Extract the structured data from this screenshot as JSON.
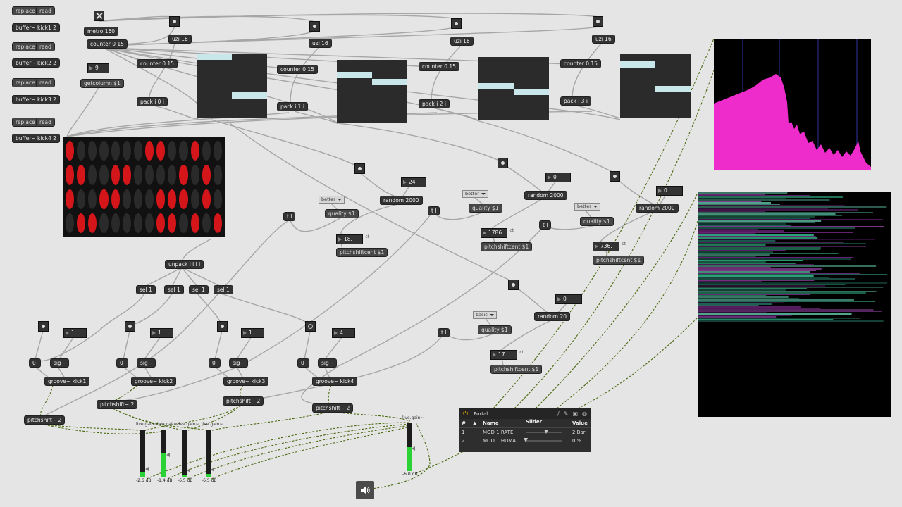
{
  "messages": {
    "replace": "replace",
    "read": "read",
    "getcolumn": "getcolumn $1",
    "quality": "quality $1",
    "pitchshiftcent": "pitchshiftcent $1"
  },
  "buffers": [
    "buffer~ kick1 2",
    "buffer~ kick2 2",
    "buffer~ kick3 2",
    "buffer~ kick4 2"
  ],
  "objects": {
    "metro": "metro 160",
    "counter_main": "counter 0 15",
    "uzi": "uzi 16",
    "counter": "counter 0 15",
    "pack": [
      "pack i 0 i",
      "pack i 1 i",
      "pack i 2 i",
      "pack i 3 i"
    ],
    "unpack": "unpack i i i i",
    "sel": [
      "sel 1",
      "sel 1",
      "sel 1",
      "sel 1"
    ],
    "random2000": "random 2000",
    "random20": "random 20",
    "trigger": "t l",
    "sig": "sig~",
    "groove": [
      "groove~ kick1",
      "groove~ kick2",
      "groove~ kick3",
      "groove~ kick4"
    ],
    "pitchshift": "pitchshift~ 2"
  },
  "numbers": {
    "column_index": "9",
    "random_max": "24",
    "zero": "0",
    "cent_values": [
      "18.",
      "1786.",
      "736.",
      "17."
    ],
    "cent_unit": "ct",
    "speeds": [
      "1.",
      "1.",
      "1.",
      "4."
    ]
  },
  "menus": {
    "quality_options": [
      "better",
      "better",
      "better",
      "basic"
    ]
  },
  "step_grid": {
    "rows": 4,
    "cols": 14,
    "active": [
      [
        1,
        0,
        0,
        0,
        0,
        0,
        0,
        1,
        1,
        0,
        0,
        1,
        0,
        0
      ],
      [
        1,
        1,
        0,
        0,
        1,
        1,
        0,
        0,
        0,
        0,
        1,
        0,
        1,
        0
      ],
      [
        1,
        0,
        0,
        1,
        1,
        0,
        0,
        0,
        1,
        1,
        1,
        0,
        1,
        0
      ],
      [
        0,
        1,
        1,
        0,
        0,
        0,
        0,
        0,
        1,
        1,
        0,
        1,
        0,
        1
      ]
    ],
    "on_color": "#d4161b",
    "off_color": "#2a2a2a"
  },
  "gain_sliders": [
    {
      "label": "live.gain~",
      "value": "-2.6 dB",
      "level": 0.1
    },
    {
      "label": "live.gain~",
      "value": "-1.4 dB",
      "level": 0.5
    },
    {
      "label": "live.gain~",
      "value": "-6.5 dB",
      "level": 0.06
    },
    {
      "label": "live.gain~",
      "value": "-6.5 dB",
      "level": 0.08
    },
    {
      "label": "live.gain~",
      "value": "-6.0 dB",
      "level": 0.5
    }
  ],
  "portal": {
    "title": "Portal",
    "columns": {
      "index": "#",
      "name": "Name",
      "slider": "Slider",
      "value": "Value"
    },
    "rows": [
      {
        "index": "1",
        "name": "MOD 1 RATE",
        "value": "2 Bar",
        "level": 0.55
      },
      {
        "index": "2",
        "name": "MOD 1 HUMA...",
        "value": "0 %",
        "level": 0.0
      }
    ]
  },
  "icons": {
    "speaker": "speaker-icon",
    "power": "power-icon",
    "wrench": "wrench-icon",
    "camera": "camera-icon",
    "search": "search-icon"
  },
  "colors": {
    "spectrum": "#ee2ccc",
    "sonogram_primary": "#3dd7a3",
    "sonogram_secondary": "#8a2f9c",
    "table_bar": "#c9e6ea",
    "meter": "#2ad236"
  }
}
